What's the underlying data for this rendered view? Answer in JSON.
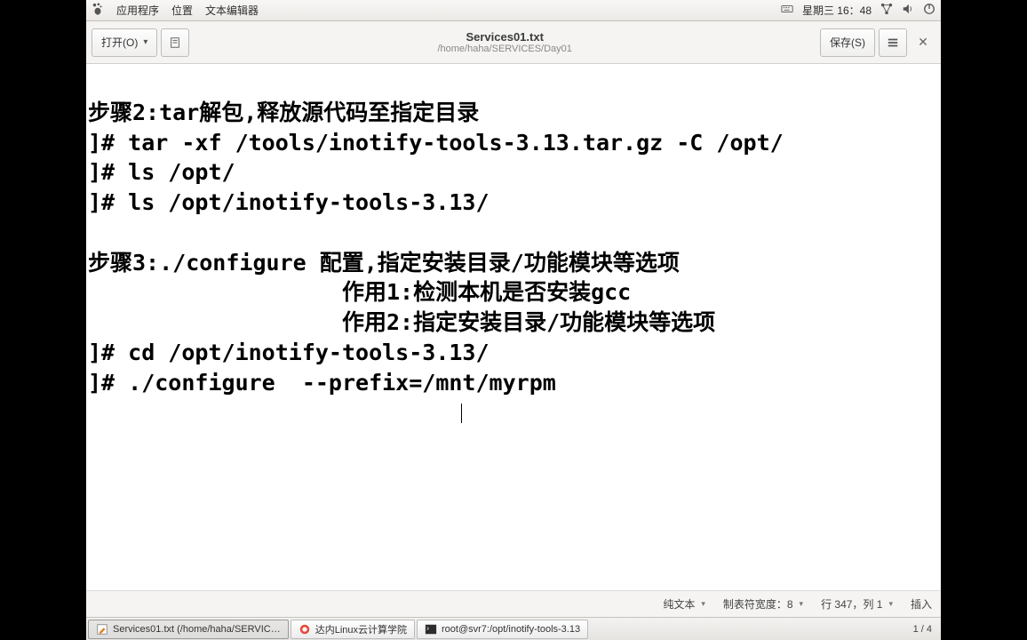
{
  "menubar": {
    "apps": "应用程序",
    "places": "位置",
    "editor": "文本编辑器",
    "datetime": "星期三 16：48"
  },
  "toolbar": {
    "open": "打开(O)",
    "save": "保存(S)",
    "title": "Services01.txt",
    "subtitle": "/home/haha/SERVICES/Day01"
  },
  "editor": {
    "lines": [
      "步骤2:tar解包,释放源代码至指定目录",
      "]# tar -xf /tools/inotify-tools-3.13.tar.gz -C /opt/",
      "]# ls /opt/",
      "]# ls /opt/inotify-tools-3.13/",
      "",
      "步骤3:./configure 配置,指定安装目录/功能模块等选项",
      "                   作用1:检测本机是否安装gcc",
      "                   作用2:指定安装目录/功能模块等选项",
      "]# cd /opt/inotify-tools-3.13/",
      "]# ./configure  --prefix=/mnt/myrpm"
    ]
  },
  "statusbar": {
    "plain_text": "纯文本",
    "tab_width": "制表符宽度：8",
    "position": "行 347，列 1",
    "insert_mode": "插入"
  },
  "taskbar": {
    "task1": "Services01.txt (/home/haha/SERVIC…",
    "task2": "达内Linux云计算学院",
    "task3": "root@svr7:/opt/inotify-tools-3.13",
    "pager": "1 / 4"
  }
}
